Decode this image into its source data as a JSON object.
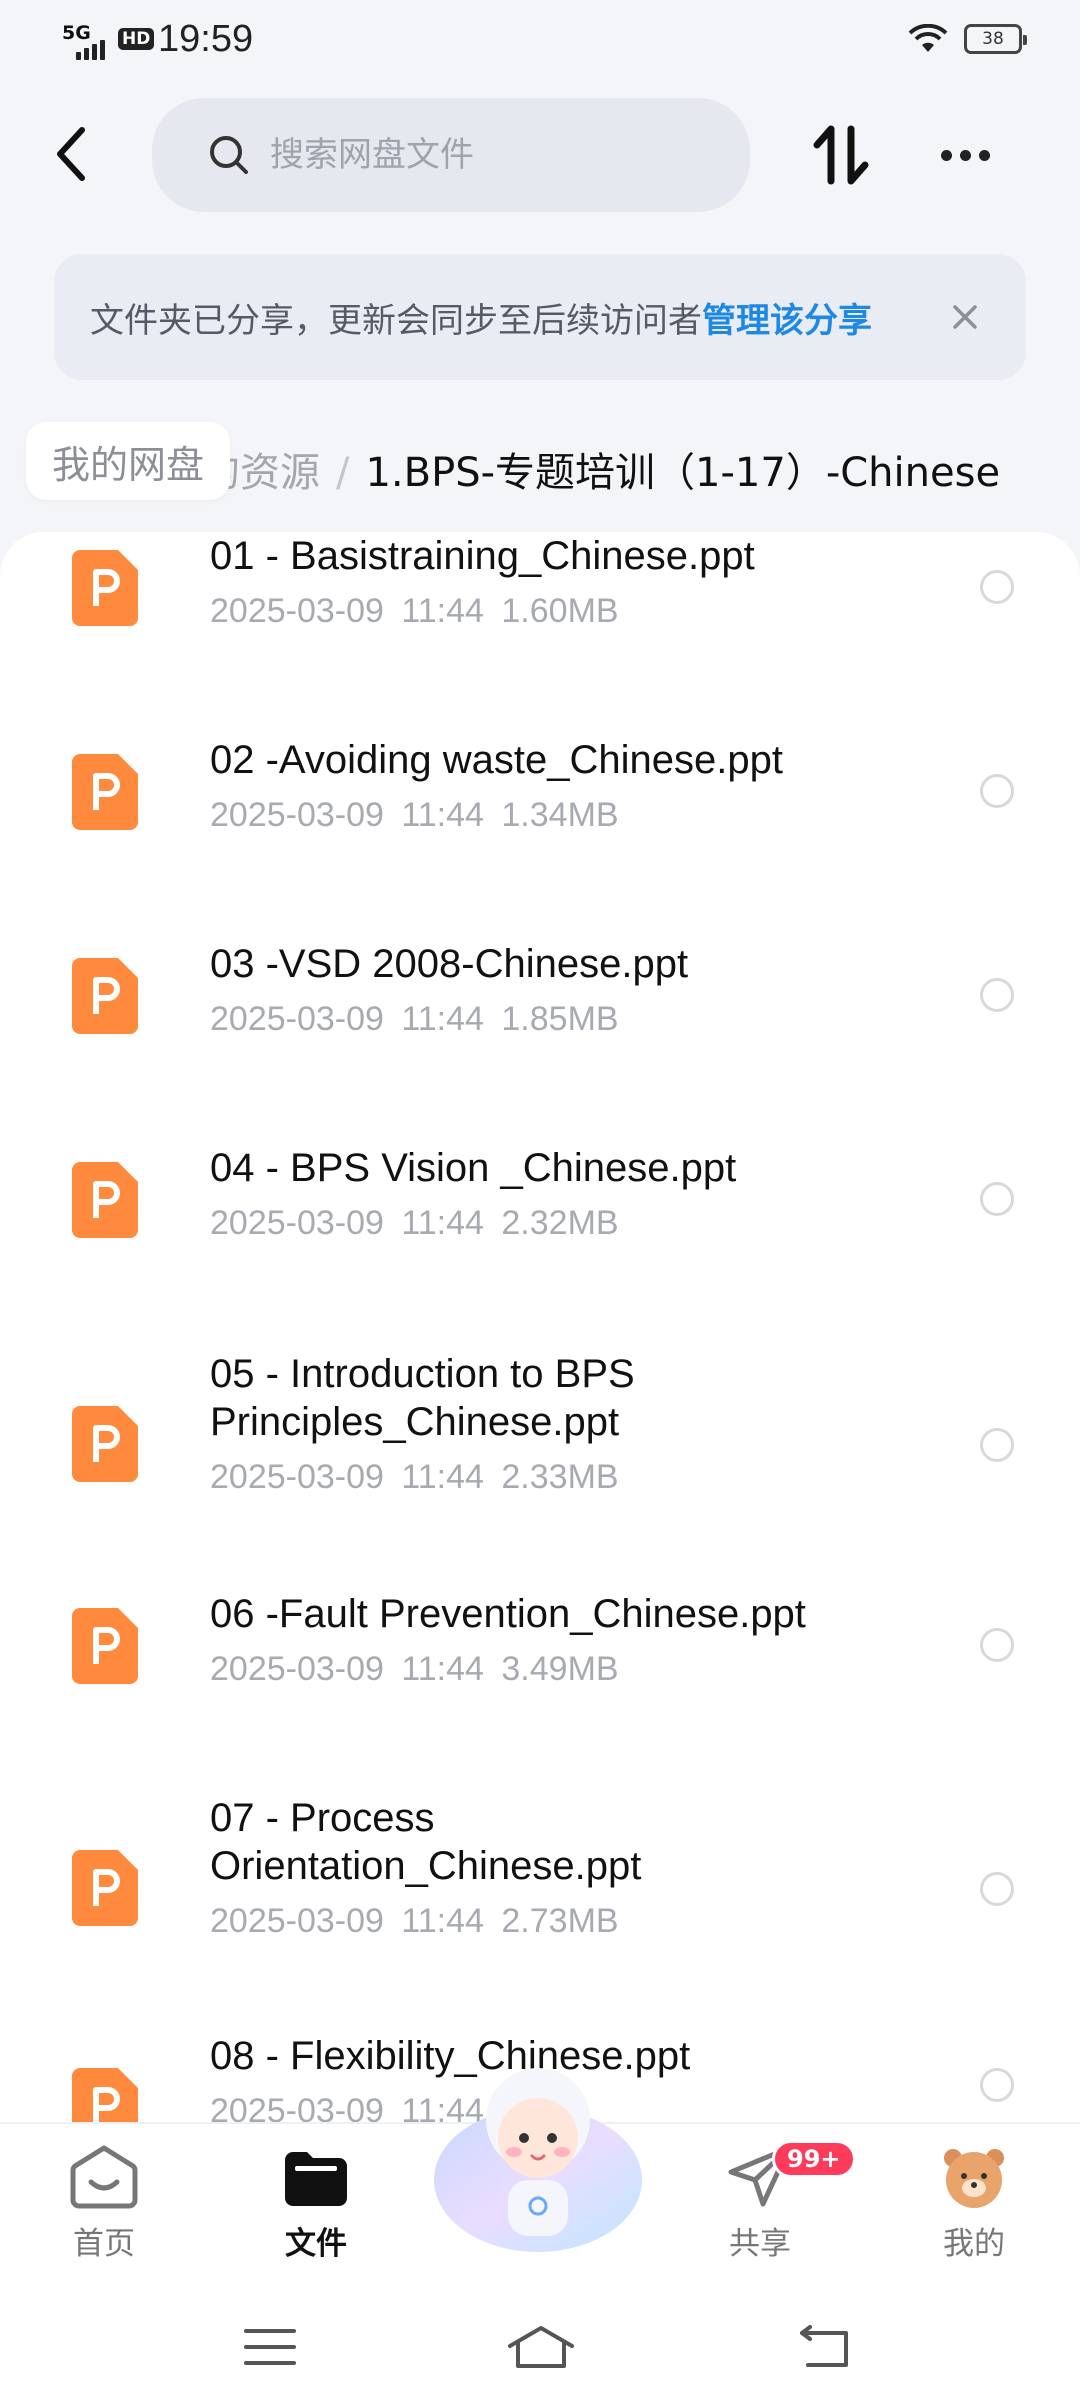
{
  "status_bar": {
    "network": "5G",
    "hd": "HD",
    "time": "19:59",
    "battery": "38"
  },
  "search": {
    "placeholder": "搜索网盘文件"
  },
  "banner": {
    "text": "文件夹已分享，更新会同步至后续访问者",
    "link": "管理该分享"
  },
  "breadcrumb": {
    "home": "我的网盘",
    "middle": "的资源",
    "separator": "/",
    "current": "1.BPS-专题培训（1-17）-Chinese"
  },
  "files": [
    {
      "name": "01 - Basistraining_Chinese.ppt",
      "date": "2025-03-09",
      "time": "11:44",
      "size": "1.60MB"
    },
    {
      "name": "02 -Avoiding waste_Chinese.ppt",
      "date": "2025-03-09",
      "time": "11:44",
      "size": "1.34MB"
    },
    {
      "name": "03 -VSD 2008-Chinese.ppt",
      "date": "2025-03-09",
      "time": "11:44",
      "size": "1.85MB"
    },
    {
      "name": "04 - BPS Vision _Chinese.ppt",
      "date": "2025-03-09",
      "time": "11:44",
      "size": "2.32MB"
    },
    {
      "name": "05 - Introduction to BPS Principles_Chinese.ppt",
      "date": "2025-03-09",
      "time": "11:44",
      "size": "2.33MB"
    },
    {
      "name": "06 -Fault Prevention_Chinese.ppt",
      "date": "2025-03-09",
      "time": "11:44",
      "size": "3.49MB"
    },
    {
      "name": "07 - Process Orientation_Chinese.ppt",
      "date": "2025-03-09",
      "time": "11:44",
      "size": "2.73MB"
    },
    {
      "name": "08 - Flexibility_Chinese.ppt",
      "date": "2025-03-09",
      "time": "11:44",
      "size": ""
    }
  ],
  "bottom_nav": {
    "home": "首页",
    "files": "文件",
    "share": "共享",
    "share_badge": "99+",
    "mine": "我的"
  },
  "colors": {
    "accent": "#1e88e5",
    "ppt_icon": "#ff8a3d",
    "badge": "#ff3b5c"
  }
}
